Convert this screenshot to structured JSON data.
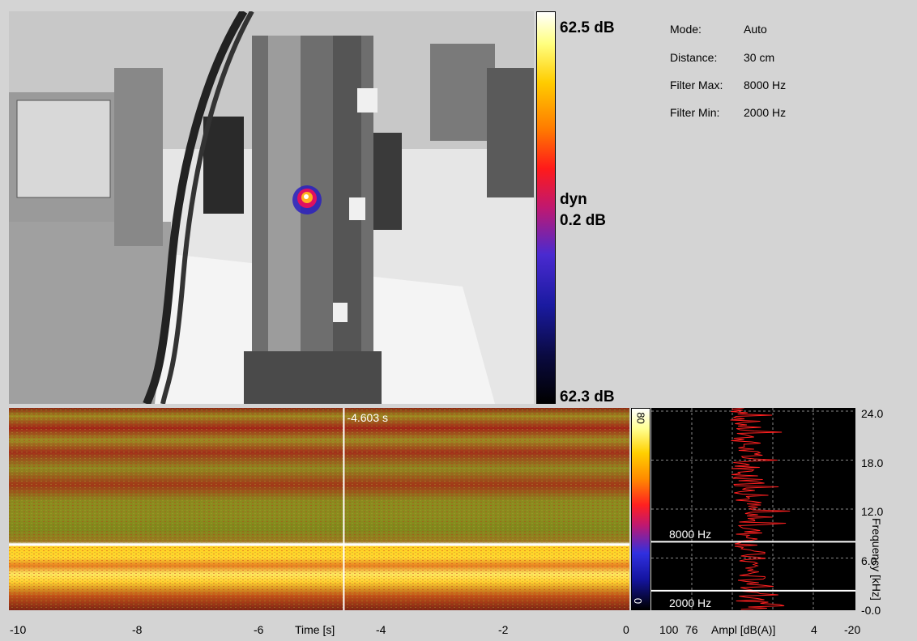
{
  "colorbar": {
    "max_label": "62.5 dB",
    "dyn_label": "dyn",
    "dyn_value": "0.2 dB",
    "min_label": "62.3 dB"
  },
  "info": [
    {
      "key": "Mode:",
      "value": "Auto"
    },
    {
      "key": "Distance:",
      "value": "30 cm"
    },
    {
      "key": "Filter Max:",
      "value": "8000 Hz"
    },
    {
      "key": "Filter Min:",
      "value": "2000 Hz"
    }
  ],
  "spectrogram": {
    "cursor_label": "-4.603 s",
    "cursor_time": -4.603,
    "x_ticks": [
      "-10",
      "-8",
      "-6",
      "-4",
      "-2",
      "0"
    ],
    "x_label": "Time [s]"
  },
  "small_colorbar": {
    "top": "80",
    "bottom": "0"
  },
  "spectrum": {
    "filter_max_label": "8000 Hz",
    "filter_min_label": "2000 Hz",
    "x_ticks": [
      "100",
      "76",
      "4",
      "-20"
    ],
    "x_label": "Ampl [dB(A)]",
    "y_ticks": [
      "24.0",
      "18.0",
      "12.0",
      "6.0",
      "-0.0"
    ],
    "y_label": "Frequency [kHz]"
  },
  "colors": {
    "trace": "#ff2020",
    "filter_line": "#ffffff",
    "background": "#d4d4d4"
  }
}
